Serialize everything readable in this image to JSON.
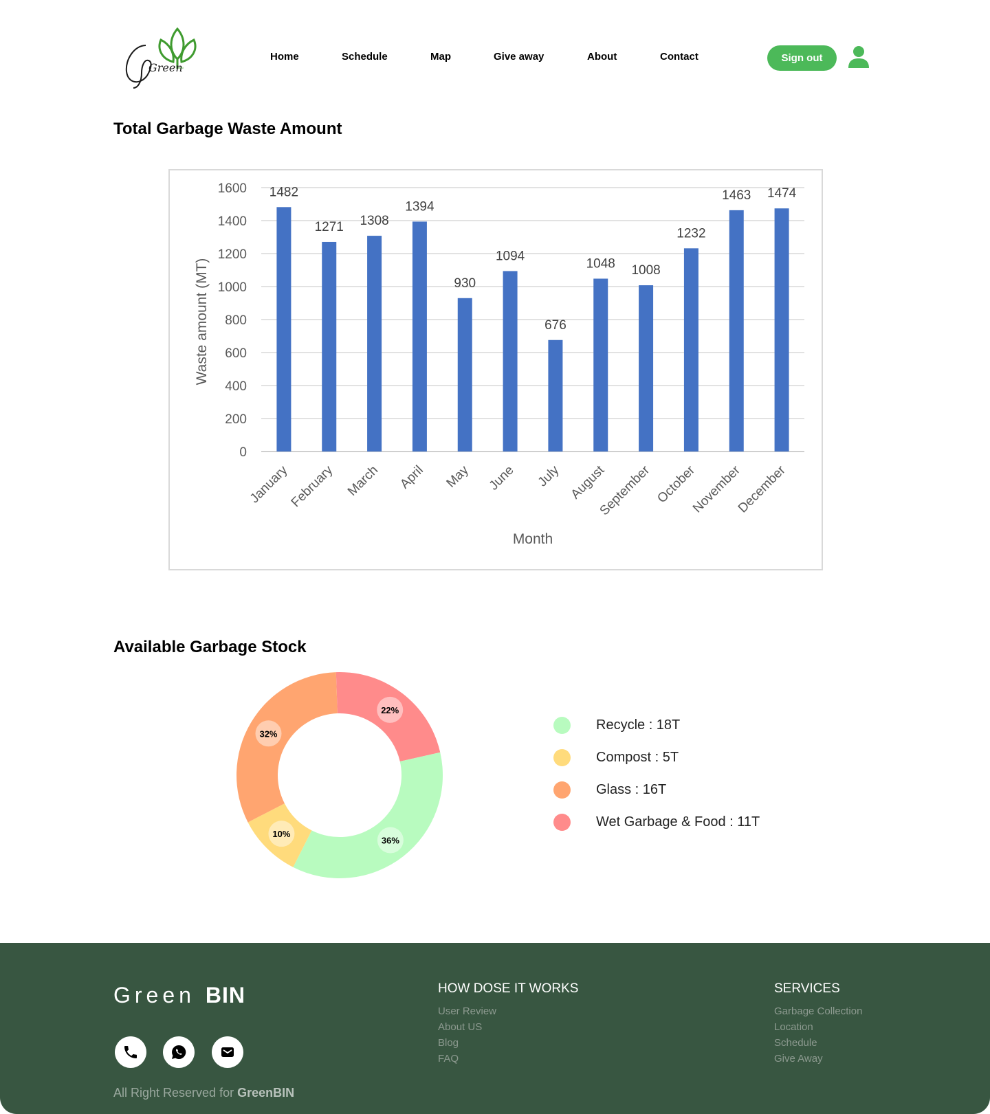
{
  "brand": {
    "logo_text": "Green",
    "logo_small": "BIN"
  },
  "nav": {
    "items": [
      "Home",
      "Schedule",
      "Map",
      "Give away",
      "About",
      "Contact"
    ],
    "sign_out": "Sign out"
  },
  "sections": {
    "total_title": "Total Garbage Waste Amount",
    "stock_title": "Available Garbage Stock"
  },
  "chart_data": [
    {
      "type": "bar",
      "xlabel": "Month",
      "ylabel": "Waste amount (MT)",
      "categories": [
        "January",
        "February",
        "March",
        "April",
        "May",
        "June",
        "July",
        "August",
        "September",
        "October",
        "November",
        "December"
      ],
      "values": [
        1482,
        1271,
        1308,
        1394,
        930,
        1094,
        676,
        1048,
        1008,
        1232,
        1463,
        1474
      ],
      "ylim": [
        0,
        1600
      ],
      "yticks": [
        0,
        200,
        400,
        600,
        800,
        1000,
        1200,
        1400,
        1600
      ],
      "grid": true,
      "color": "#4472c4"
    },
    {
      "type": "pie",
      "donut": true,
      "slices": [
        {
          "label": "Recycle",
          "percent": 36,
          "percent_label": "36%",
          "color": "#b8fbbf"
        },
        {
          "label": "Compost",
          "percent": 10,
          "percent_label": "10%",
          "color": "#ffdb7c"
        },
        {
          "label": "Glass",
          "percent": 32,
          "percent_label": "32%",
          "color": "#ffa570"
        },
        {
          "label": "Wet Garbage & Food",
          "percent": 22,
          "percent_label": "22%",
          "color": "#ff8b8b"
        }
      ]
    }
  ],
  "legend": [
    {
      "text": "Recycle : 18T",
      "color": "#b8fbbf"
    },
    {
      "text": "Compost : 5T",
      "color": "#ffdb7c"
    },
    {
      "text": "Glass : 16T",
      "color": "#ffa570"
    },
    {
      "text": "Wet Garbage & Food : 11T",
      "color": "#ff8b8b"
    }
  ],
  "footer": {
    "brand_light": "Green",
    "brand_bold": "BIN",
    "copyright_prefix": "All Right Reserved for",
    "copyright_brand": "GreenBIN",
    "col1": {
      "title": "HOW DOSE IT WORKS",
      "links": [
        "User Review",
        "About US",
        "Blog",
        "FAQ"
      ]
    },
    "col2": {
      "title": "SERVICES",
      "links": [
        "Garbage Collection",
        "Location",
        "Schedule",
        "Give Away"
      ]
    },
    "social": [
      "phone-icon",
      "whatsapp-icon",
      "mail-icon"
    ]
  },
  "colors": {
    "accent": "#4cb959",
    "footer_bg": "#385641",
    "bar": "#4472c4"
  }
}
